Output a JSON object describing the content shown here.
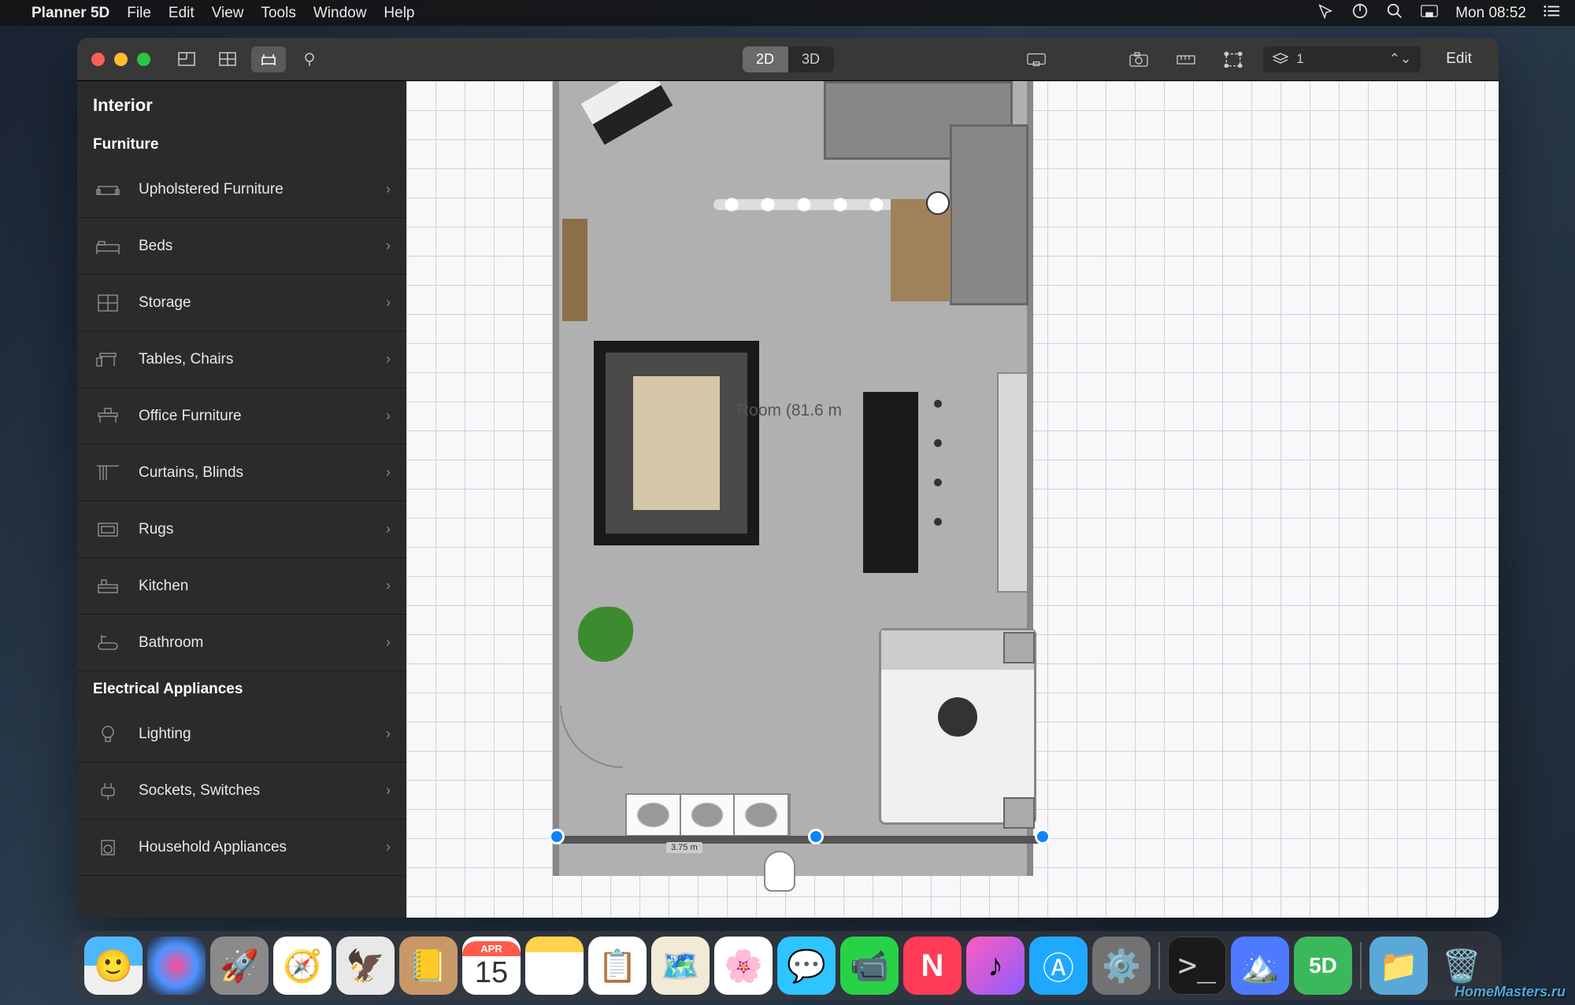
{
  "menubar": {
    "app_name": "Planner 5D",
    "items": [
      "File",
      "Edit",
      "View",
      "Tools",
      "Window",
      "Help"
    ],
    "clock": "Mon 08:52"
  },
  "toolbar": {
    "view_2d": "2D",
    "view_3d": "3D",
    "layer_value": "1",
    "edit": "Edit"
  },
  "sidebar": {
    "title": "Interior",
    "section_furniture": "Furniture",
    "section_electrical": "Electrical Appliances",
    "furniture_items": [
      "Upholstered Furniture",
      "Beds",
      "Storage",
      "Tables, Chairs",
      "Office Furniture",
      "Curtains, Blinds",
      "Rugs",
      "Kitchen",
      "Bathroom"
    ],
    "electrical_items": [
      "Lighting",
      "Sockets, Switches",
      "Household Appliances"
    ]
  },
  "canvas": {
    "room_label": "Room (81.6 m",
    "dim_bottom": "3.75 m"
  },
  "dock": {
    "cal_month": "APR",
    "cal_day": "15"
  },
  "watermark": "HomeMasters.ru"
}
